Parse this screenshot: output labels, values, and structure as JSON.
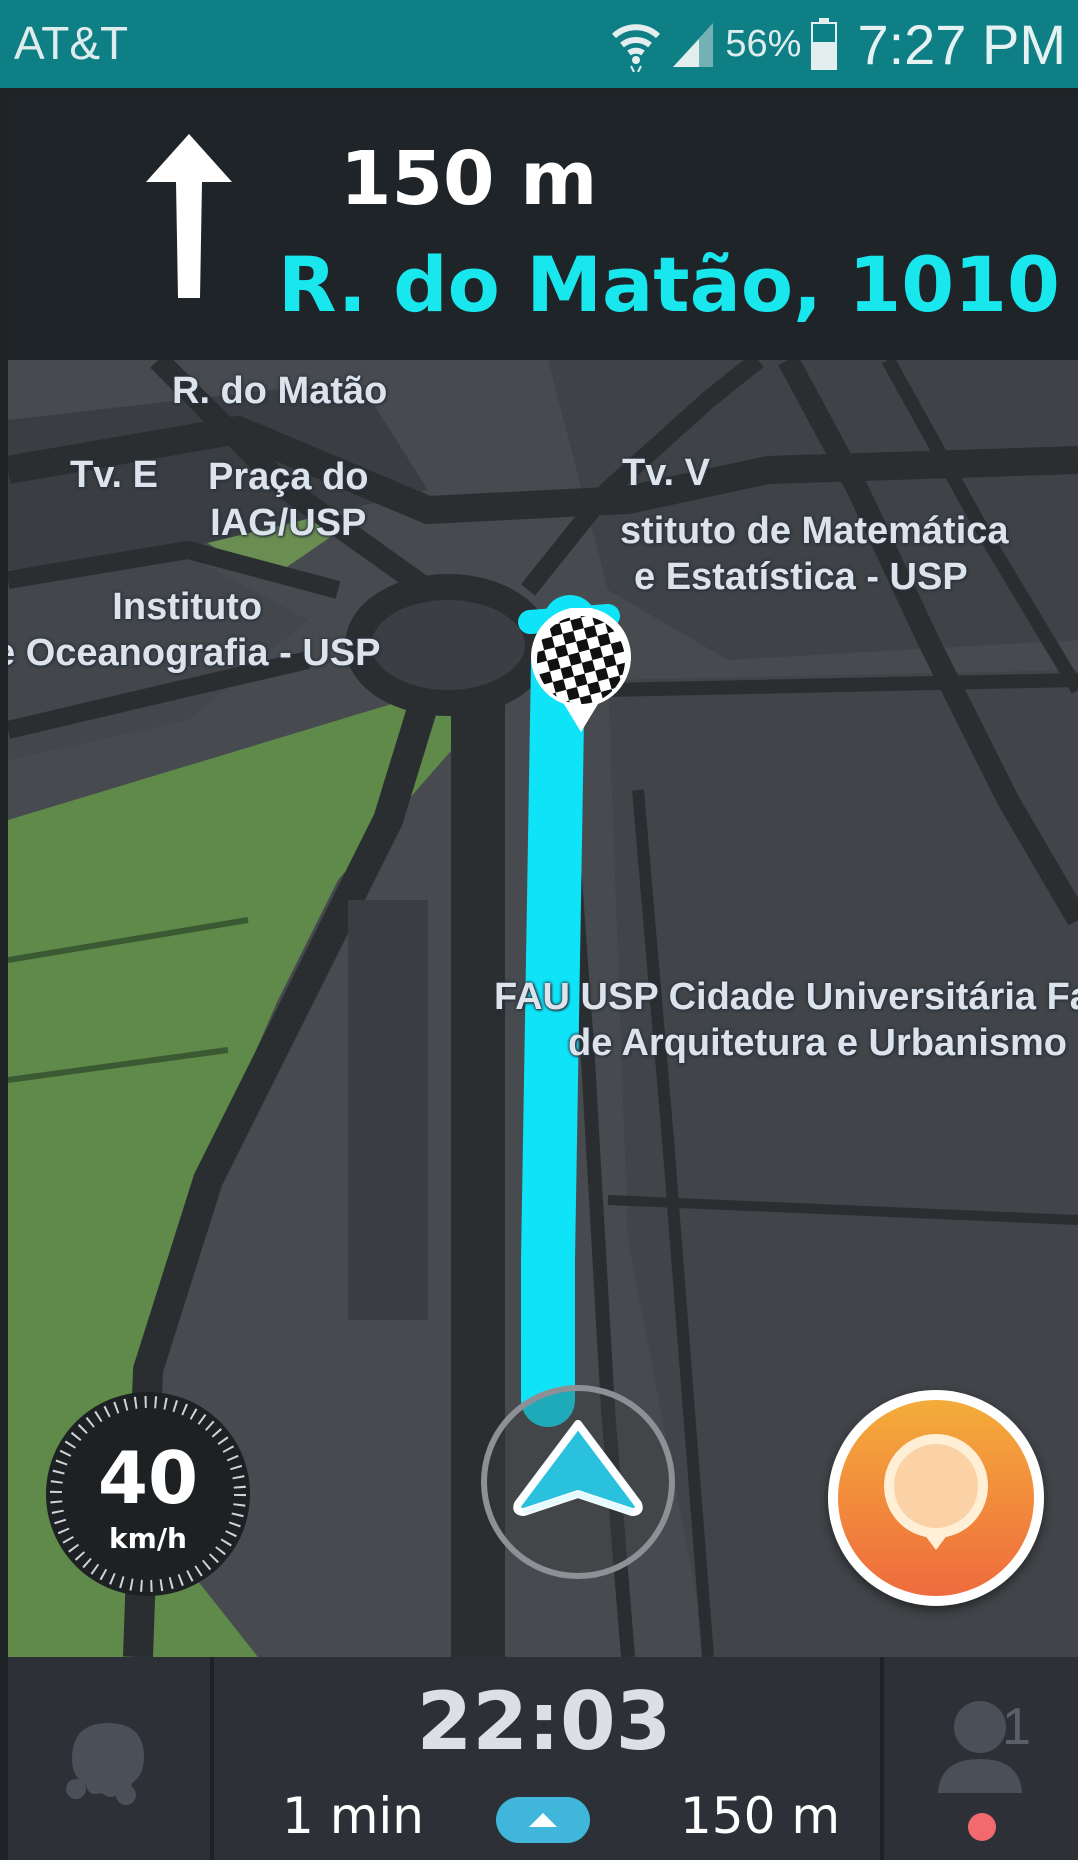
{
  "status_bar": {
    "carrier": "AT&T",
    "battery_percent": "56%",
    "time": "7:27 PM",
    "icons": [
      "wifi-icon",
      "signal-icon",
      "battery-icon"
    ]
  },
  "instruction": {
    "direction_icon": "arrow-up-icon",
    "distance": "150 m",
    "street": "R. do Matão, 1010"
  },
  "map": {
    "labels": {
      "rua_matao": "R. do Matão",
      "tv_e": "Tv. E",
      "praca_line1": "Praça do",
      "praca_line2": "IAG/USP",
      "tv_v": "Tv. V",
      "ime_line1": "stituto de Matemática",
      "ime_line2": "e Estatística - USP",
      "oceano_line1": "Instituto",
      "oceano_line2": "e Oceanografia - USP",
      "fau_line1": "FAU USP Cidade Universitária Fa",
      "fau_line2": "de Arquitetura e Urbanismo"
    },
    "route_color": "#0fe3f8",
    "destination_icon": "checkered-flag-icon"
  },
  "speedometer": {
    "speed": "40",
    "unit": "km/h"
  },
  "report_button": {
    "icon": "report-pin-icon",
    "color": "#f28a3c"
  },
  "bottom_bar": {
    "arrival_time": "22:03",
    "duration": "1 min",
    "distance": "150 m",
    "menu_icon": "wazer-menu-icon",
    "expand_icon": "chevron-up-icon",
    "friends_icon": "person-icon",
    "friends_count": "1"
  }
}
